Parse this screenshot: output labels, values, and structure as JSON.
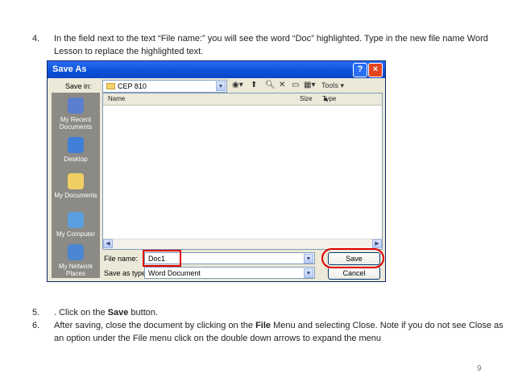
{
  "steps": [
    {
      "number": "4.",
      "text": "In the field next to the text “File name:” you will see the word “Doc” highlighted. Type in the new file name Word Lesson to replace the highlighted text."
    },
    {
      "number": "5.",
      "prefix": ". Click on the ",
      "bold": "Save",
      "suffix": " button."
    },
    {
      "number": "6.",
      "prefix": "After saving, close the document by clicking on the ",
      "bold": "File",
      "suffix": " Menu and selecting Close. Note if you do not see Close as an option under the File menu click on the double down arrows to expand the menu"
    }
  ],
  "dialog": {
    "title": "Save As",
    "help": "?",
    "close": "×",
    "save_in_label": "Save in:",
    "save_in_value": "CEP 810",
    "tools_label": "Tools",
    "places": [
      "My Recent Documents",
      "Desktop",
      "My Documents",
      "My Computer",
      "My Network Places"
    ],
    "columns": {
      "name": "Name",
      "size": "Size",
      "type": "Type"
    },
    "file_name_label": "File name:",
    "file_name_value": "Doc1",
    "save_as_type_label": "Save as type:",
    "save_as_type_value": "Word Document",
    "save_button": "Save",
    "cancel_button": "Cancel"
  },
  "page_number": "9",
  "colors": {
    "highlight": "#e00000",
    "titlebar": "#0a50d8"
  }
}
